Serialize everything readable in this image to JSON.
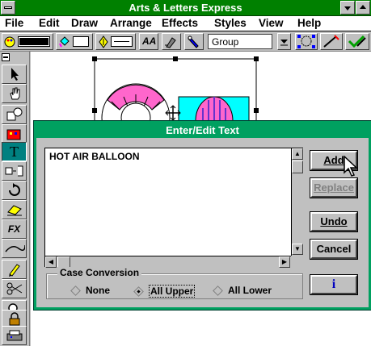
{
  "window": {
    "title": "Arts & Letters Express"
  },
  "menu": [
    "File",
    "Edit",
    "Draw",
    "Arrange",
    "Effects",
    "Styles",
    "View",
    "Help"
  ],
  "toolbar": {
    "group_value": "Group"
  },
  "dialog": {
    "title": "Enter/Edit Text",
    "text": "HOT AIR BALLOON",
    "buttons": {
      "add": "Add",
      "replace": "Replace",
      "undo": "Undo",
      "cancel": "Cancel",
      "info": "i"
    },
    "case_conversion": {
      "label": "Case Conversion",
      "options": [
        "None",
        "All Upper",
        "All Lower"
      ],
      "selected": "All Upper"
    }
  },
  "colors": {
    "title_bg": "#008000",
    "dialog_accent": "#00a060",
    "active_tool": "#008080"
  }
}
